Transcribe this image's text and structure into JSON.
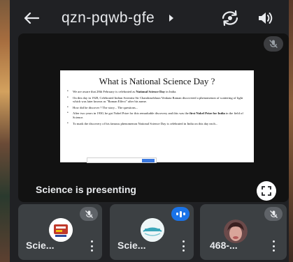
{
  "header": {
    "meeting_code": "qzn-pqwb-gfe"
  },
  "icons": {
    "back": "arrow-left-icon",
    "switch_camera": "switch-camera-icon",
    "audio": "speaker-icon",
    "mic_off": "mic-off-icon",
    "fullscreen": "fullscreen-icon",
    "more": "more-vert-icon",
    "speaking": "audio-level-icon"
  },
  "presentation": {
    "presenting_label": "Science is presenting",
    "slide": {
      "title": "What is National Science Day ?",
      "bullets": [
        {
          "text": "We are aware that 28th February is celebrated as ",
          "bold": "National Science Day",
          "after": " in India."
        },
        {
          "text": "On this day in 1928, Celebrated Indian Scientist Sir Chandrasekhara Venkata Raman discovered a phenomenon of scattering of light which was later known as \"Raman Effect\" after his name.",
          "bold": "",
          "after": ""
        },
        {
          "text": "How did he discover ? The story... The questions...",
          "bold": "",
          "after": ""
        },
        {
          "text": "After two years in 1930, he got Nobel Prize for this remarkable discovery and this was the ",
          "bold": "first Nobel Prize for India",
          "after": " in the field of Science."
        },
        {
          "text": "To mark the discovery of his famous phenomenon National Science Day is celebrated in India on this day each...",
          "bold": "",
          "after": ""
        }
      ]
    }
  },
  "participants": [
    {
      "name": "Scie...",
      "mic": "muted",
      "avatar": "logo-badge"
    },
    {
      "name": "Scie...",
      "mic": "speaking",
      "avatar": "science-logo"
    },
    {
      "name": "468-...",
      "mic": "muted",
      "avatar": "photo"
    }
  ],
  "colors": {
    "background": "#202124",
    "tile": "#3c4043",
    "speaking_accent": "#1a73e8",
    "text": "#e8eaed"
  }
}
